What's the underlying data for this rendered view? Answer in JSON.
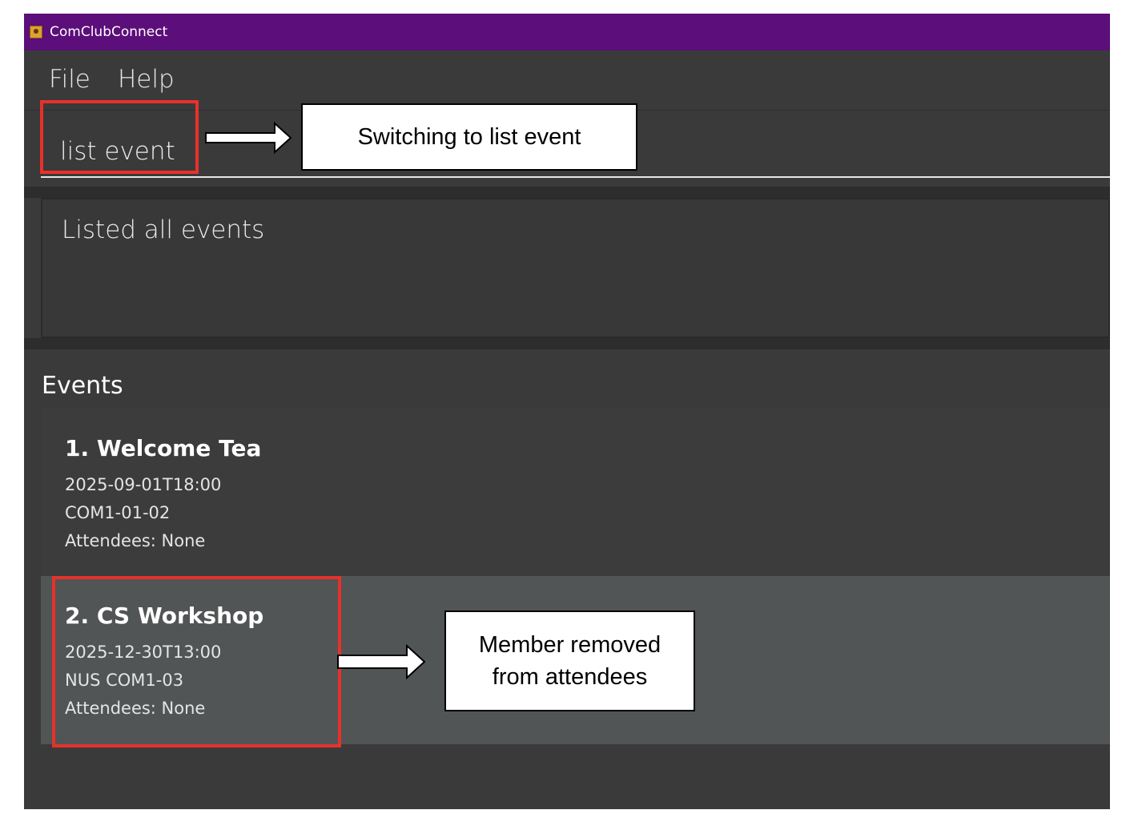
{
  "window": {
    "title": "ComClubConnect",
    "title_bar_color": "#5c0e7a"
  },
  "menu": {
    "items": [
      "File",
      "Help"
    ]
  },
  "command": {
    "value": "list event"
  },
  "result": {
    "message": "Listed all events"
  },
  "events": {
    "heading": "Events",
    "cards": [
      {
        "name": "1. Welcome Tea",
        "datetime": "2025-09-01T18:00",
        "location": "COM1-01-02",
        "attendees": "Attendees: None"
      },
      {
        "name": "2. CS Workshop",
        "datetime": "2025-12-30T13:00",
        "location": "NUS COM1-03",
        "attendees": "Attendees: None"
      }
    ]
  },
  "annotations": {
    "command_note": "Switching to list event",
    "event_note_line1": "Member removed",
    "event_note_line2": "from attendees",
    "highlight_color": "#e8312a"
  }
}
